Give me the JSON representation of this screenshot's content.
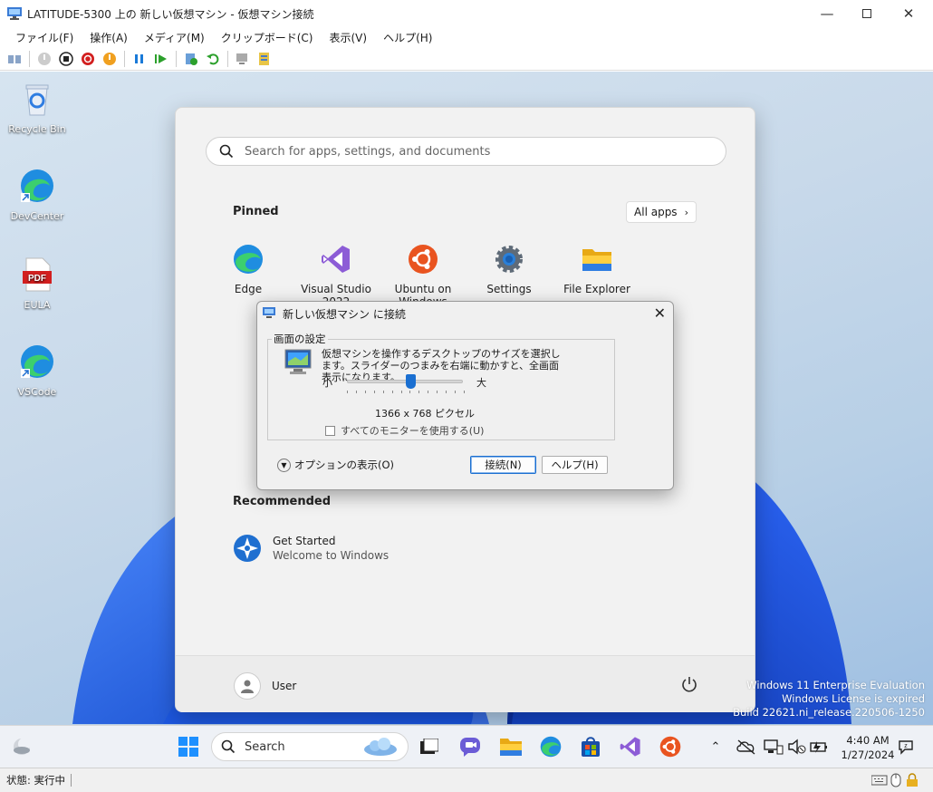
{
  "window": {
    "title": "LATITUDE-5300 上の 新しい仮想マシン - 仮想マシン接続"
  },
  "menu": [
    "ファイル(F)",
    "操作(A)",
    "メディア(M)",
    "クリップボード(C)",
    "表示(V)",
    "ヘルプ(H)"
  ],
  "desktop_icons": [
    {
      "label": "Recycle Bin",
      "icon": "recycle-bin-icon"
    },
    {
      "label": "DevCenter",
      "icon": "edge-icon"
    },
    {
      "label": "EULA",
      "icon": "pdf-icon"
    },
    {
      "label": "VSCode",
      "icon": "edge-icon"
    }
  ],
  "pdf_badge": "PDF",
  "start": {
    "search_placeholder": "Search for apps, settings, and documents",
    "pinned_title": "Pinned",
    "all_apps": "All apps",
    "apps": [
      {
        "label": "Edge",
        "icon": "edge-icon"
      },
      {
        "label": "Visual Studio 2022",
        "icon": "visual-studio-icon"
      },
      {
        "label": "Ubuntu on Windows",
        "icon": "ubuntu-icon"
      },
      {
        "label": "Settings",
        "icon": "settings-gear-icon"
      },
      {
        "label": "File Explorer",
        "icon": "folder-icon"
      }
    ],
    "recommended_title": "Recommended",
    "recommended": [
      {
        "title": "Get Started",
        "subtitle": "Welcome to Windows"
      }
    ],
    "user": "User"
  },
  "dialog": {
    "title": "新しい仮想マシン に接続",
    "group_label": "画面の設定",
    "description": "仮想マシンを操作するデスクトップのサイズを選択します。スライダーのつまみを右端に動かすと、全画面表示になります。",
    "small_label": "小",
    "large_label": "大",
    "resolution": "1366 x 768 ピクセル",
    "slider_level": 0.55,
    "all_monitors_label": "すべてのモニターを使用する(U)",
    "all_monitors_checked": false,
    "options_label": "オプションの表示(O)",
    "connect_label": "接続(N)",
    "help_label": "ヘルプ(H)"
  },
  "watermark": [
    "Windows 11 Enterprise Evaluation",
    "Windows License is expired",
    "Build 22621.ni_release.220506-1250"
  ],
  "taskbar": {
    "search_label": "Search",
    "time": "4:40 AM",
    "date": "1/27/2024"
  },
  "status": {
    "text": "状態: 実行中"
  },
  "colors": {
    "accent": "#1a6fd1",
    "desktop": "#c8d9ea"
  }
}
